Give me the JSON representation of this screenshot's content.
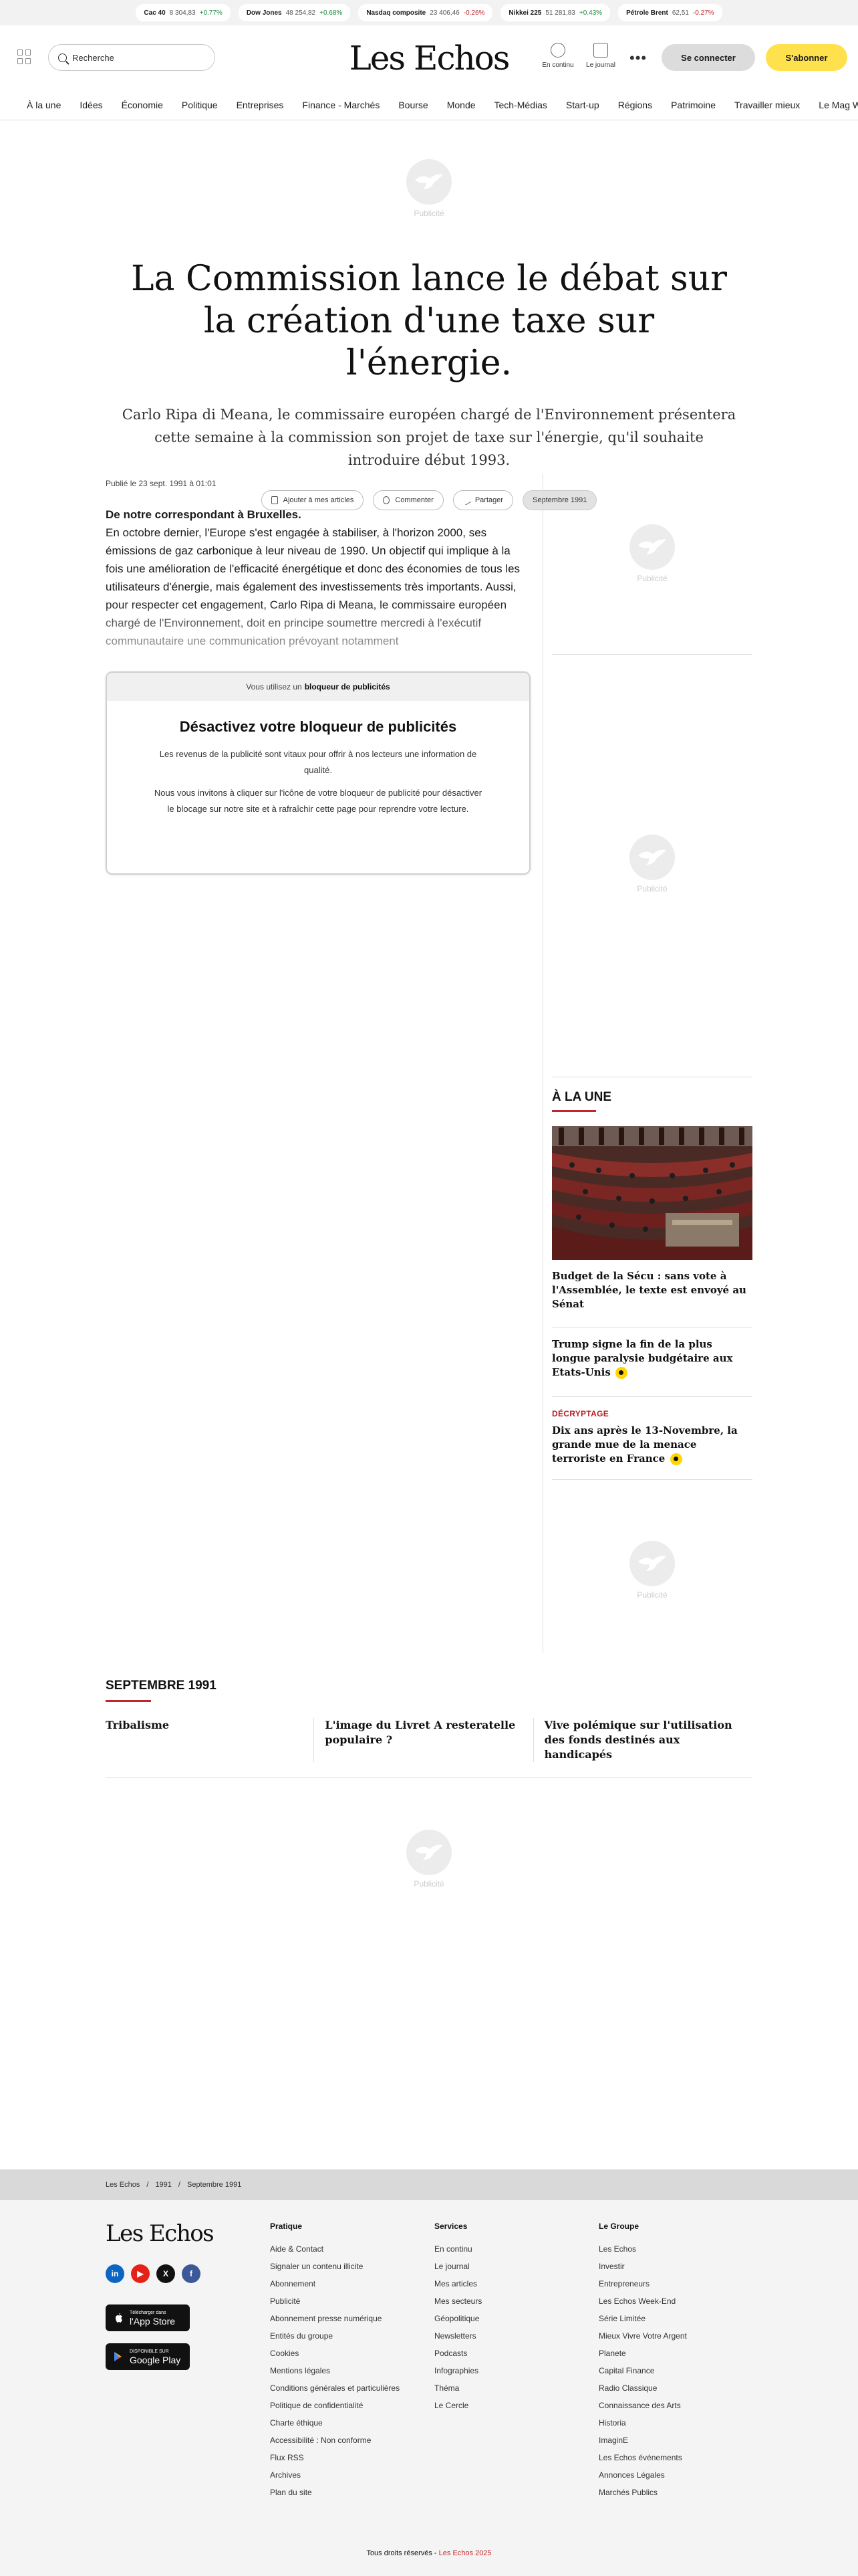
{
  "ticker": [
    {
      "name": "Cac 40",
      "value": "8 304,83",
      "change": "+0.77%",
      "dir": "up"
    },
    {
      "name": "Dow Jones",
      "value": "48 254,82",
      "change": "+0.68%",
      "dir": "up"
    },
    {
      "name": "Nasdaq composite",
      "value": "23 406,46",
      "change": "-0.26%",
      "dir": "down"
    },
    {
      "name": "Nikkei 225",
      "value": "51 281,83",
      "change": "+0.43%",
      "dir": "up"
    },
    {
      "name": "Pétrole Brent",
      "value": "62,51",
      "change": "-0.27%",
      "dir": "down"
    }
  ],
  "header": {
    "search_placeholder": "Recherche",
    "logo": "Les Echos",
    "live_label": "En continu",
    "journal_label": "Le journal",
    "more_label": "•••",
    "login_label": "Se connecter",
    "subscribe_label": "S'abonner"
  },
  "nav": [
    "À la une",
    "Idées",
    "Économie",
    "Politique",
    "Entreprises",
    "Finance - Marchés",
    "Bourse",
    "Monde",
    "Tech-Médias",
    "Start-up",
    "Régions",
    "Patrimoine",
    "Travailler mieux",
    "Le Mag W-E"
  ],
  "ad_label": "Publicité",
  "article": {
    "title": "La Commission lance le débat sur la création d'une taxe sur l'énergie.",
    "lead": "Carlo Ripa di Meana, le commissaire européen chargé de l'Environnement présentera cette semaine à la commission son projet de taxe sur l'énergie, qu'il souhaite introduire début 1993.",
    "tools": {
      "save": "Ajouter à mes articles",
      "comment": "Commenter",
      "share": "Partager",
      "date": "Septembre 1991"
    },
    "published": "Publié le 23 sept. 1991 à 01:01",
    "intro": "De notre correspondant à Bruxelles.",
    "body": "En octobre dernier, l'Europe s'est engagée à stabiliser, à l'horizon 2000, ses émissions de gaz carbonique à leur niveau de 1990. Un objectif qui implique à la fois une amélioration de l'efficacité énergétique et donc des économies de tous les utilisateurs d'énergie, mais également des investissements très importants. Aussi, pour respecter cet engagement, Carlo Ripa di Meana, le commissaire européen chargé de l'Environnement, doit en principe soumettre mercredi à l'exécutif communautaire une communication prévoyant notamment"
  },
  "adblock": {
    "top_prefix": "Vous utilisez un",
    "top_strong": "bloqueur de publicités",
    "title": "Désactivez votre bloqueur de publicités",
    "p1": "Les revenus de la publicité sont vitaux pour offrir à nos lecteurs une information de qualité.",
    "p2": "Nous vous invitons à cliquer sur l'icône de votre bloqueur de publicité pour désactiver le blocage sur notre site et à rafraîchir cette page pour reprendre votre lecture."
  },
  "sidebar": {
    "heading": "À LA UNE",
    "articles": [
      {
        "kicker": "",
        "title": "Budget de la Sécu : sans vote à l'Assemblée, le texte est envoyé au Sénat"
      },
      {
        "kicker": "",
        "title": "Trump signe la fin de la plus longue paralysie budgétaire aux Etats-Unis"
      },
      {
        "kicker": "DÉCRYPTAGE",
        "title": "Dix ans après le 13-Novembre, la grande mue de la menace terroriste en France"
      }
    ]
  },
  "month": {
    "heading": "SEPTEMBRE 1991",
    "items": [
      "Tribalisme",
      "L'image du Livret A resteratelle populaire ?",
      "Vive polémique sur l'utilisation des fonds destinés aux handicapés"
    ]
  },
  "breadcrumb": [
    "Les Echos",
    "1991",
    "Septembre 1991"
  ],
  "footer": {
    "logo": "Les Echos",
    "app_store": {
      "small": "Télécharger dans",
      "big": "l'App Store"
    },
    "google_play": {
      "small": "DISPONIBLE SUR",
      "big": "Google Play"
    },
    "columns": [
      {
        "title": "Pratique",
        "links": [
          "Aide & Contact",
          "Signaler un contenu illicite",
          "Abonnement",
          "Publicité",
          "Abonnement presse numérique",
          "Entités du groupe",
          "Cookies",
          "Mentions légales",
          "Conditions générales et particulières",
          "Politique de confidentialité",
          "Charte éthique",
          "Accessibilité : Non conforme",
          "Flux RSS",
          "Archives",
          "Plan du site"
        ]
      },
      {
        "title": "Services",
        "links": [
          "En continu",
          "Le journal",
          "Mes articles",
          "Mes secteurs",
          "Géopolitique",
          "Newsletters",
          "Podcasts",
          "Infographies",
          "Théma",
          "Le Cercle"
        ]
      },
      {
        "title": "Le Groupe",
        "links": [
          "Les Echos",
          "Investir",
          "Entrepreneurs",
          "Les Echos Week-End",
          "Série Limitée",
          "Mieux Vivre Votre Argent",
          "Planete",
          "Capital Finance",
          "Radio Classique",
          "Connaissance des Arts",
          "Historia",
          "ImaginE",
          "Les Echos événements",
          "Annonces Légales",
          "Marchés Publics"
        ]
      }
    ],
    "rights_prefix": "Tous droits réservés -",
    "rights_brand": "Les Echos 2025"
  },
  "colors": {
    "accent_red": "#c0262d",
    "subscribe_yellow": "#ffe14d",
    "up_green": "#1b8a3e"
  },
  "icons": [
    "grid-menu-icon",
    "search-icon",
    "clock-icon",
    "newspaper-icon",
    "bookmark-icon",
    "comment-icon",
    "share-icon",
    "linkedin-icon",
    "youtube-icon",
    "x-icon",
    "facebook-icon",
    "apple-icon",
    "google-play-icon"
  ]
}
